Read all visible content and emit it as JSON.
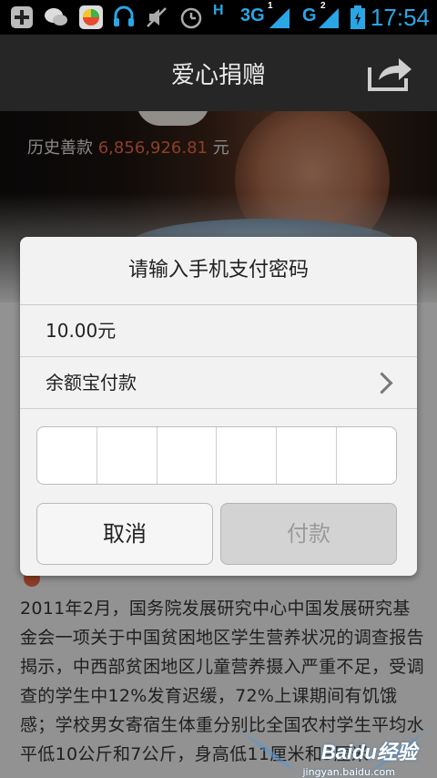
{
  "status_bar": {
    "network_3g": "3G",
    "sim1": "1",
    "network_g": "G",
    "sim2": "2",
    "time": "17:54",
    "hd_indicator": "H",
    "icons": [
      "add-icon",
      "wechat-icon",
      "browser-icon",
      "headset-icon",
      "mute-icon",
      "alarm-icon",
      "signal-icon",
      "battery-icon"
    ]
  },
  "header": {
    "title": "爱心捐赠",
    "share_icon": "share-icon"
  },
  "hero": {
    "total_label": "历史善款",
    "total_amount": "6,856,926.81",
    "total_unit": "元"
  },
  "dialog": {
    "title": "请输入手机支付密码",
    "amount": "10.00元",
    "payment_method": "余额宝付款",
    "pin_length": 6,
    "cancel_label": "取消",
    "pay_label": "付款"
  },
  "article": {
    "text": "2011年2月，国务院发展研究中心中国发展研究基金会一项关于中国贫困地区学生营养状况的调查报告揭示，中西部贫困地区儿童营养摄入严重不足，受调查的学生中12%发育迟缓，72%上课期间有饥饿感；学校男女寄宿生体重分别比全国农村学生平均水平低10公斤和7公斤，身高低11厘米和9厘米"
  },
  "watermark": {
    "brand": "Baidu经验",
    "url": "jingyan.baidu.com"
  },
  "colors": {
    "accent": "#2aa6e6",
    "amount": "#e4643e"
  }
}
